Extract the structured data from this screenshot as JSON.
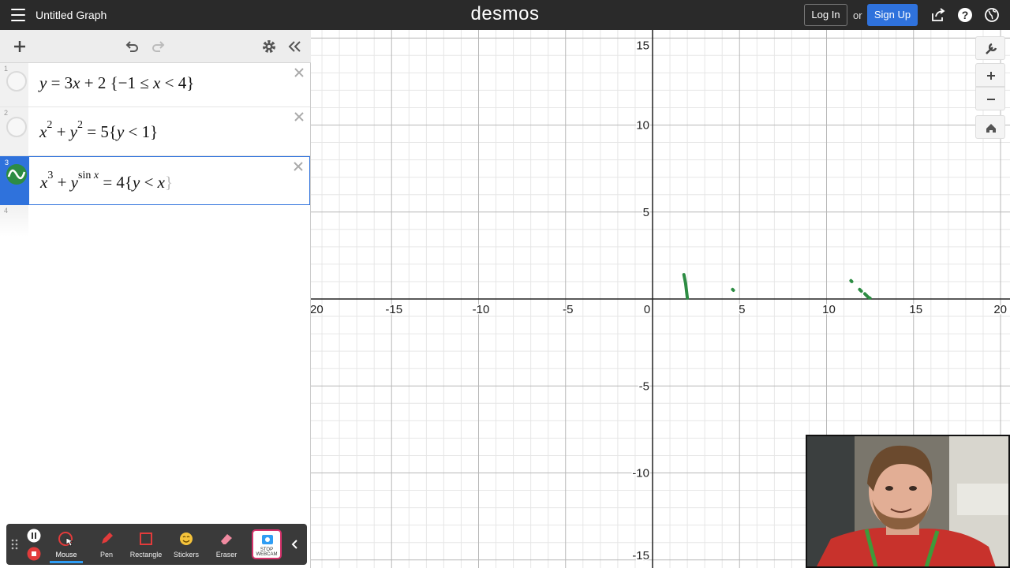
{
  "header": {
    "title": "Untitled Graph",
    "brand": "desmos",
    "login": "Log In",
    "or": "or",
    "signup": "Sign Up"
  },
  "expressions": [
    {
      "num": "1",
      "latex": "y = 3x + 2 {−1 ≤ x < 4}"
    },
    {
      "num": "2",
      "latex": "x^2 + y^2 = 5 {y < 1}"
    },
    {
      "num": "3",
      "latex": "x^3 + y^sin x = 4 {y < x}",
      "color": "#2d8c43",
      "active": true
    },
    {
      "num": "4",
      "latex": ""
    }
  ],
  "graph": {
    "x_ticks": [
      "-20",
      "-15",
      "-10",
      "-5",
      "0",
      "5",
      "10",
      "15",
      "20"
    ],
    "y_ticks": [
      "15",
      "10",
      "5",
      "-5",
      "-10",
      "-15"
    ],
    "xlim": [
      -20,
      20
    ],
    "ylim": [
      -15,
      15
    ],
    "curve_color": "#2d8c43",
    "curve_segments": [
      [
        [
          1.8,
          1.4
        ],
        [
          1.9,
          0.9
        ],
        [
          2.0,
          0.05
        ]
      ],
      [
        [
          4.6,
          0.55
        ],
        [
          4.65,
          0.5
        ]
      ],
      [
        [
          11.4,
          1.05
        ],
        [
          11.45,
          1.0
        ]
      ],
      [
        [
          11.9,
          0.55
        ],
        [
          12.0,
          0.45
        ]
      ],
      [
        [
          12.2,
          0.3
        ],
        [
          12.4,
          0.1
        ],
        [
          12.5,
          0.05
        ]
      ]
    ]
  },
  "recorder": {
    "tools": [
      {
        "label": "Mouse",
        "icon": "mouse-icon",
        "selected": true
      },
      {
        "label": "Pen",
        "icon": "pen-icon"
      },
      {
        "label": "Rectangle",
        "icon": "rectangle-icon"
      },
      {
        "label": "Stickers",
        "icon": "sticker-icon"
      },
      {
        "label": "Eraser",
        "icon": "eraser-icon"
      }
    ],
    "webcam_label_line1": "STOP",
    "webcam_label_line2": "WEBCAM"
  },
  "colors": {
    "header_bg": "#2a2a2a",
    "accent": "#2f72dc",
    "curve": "#2d8c43"
  }
}
